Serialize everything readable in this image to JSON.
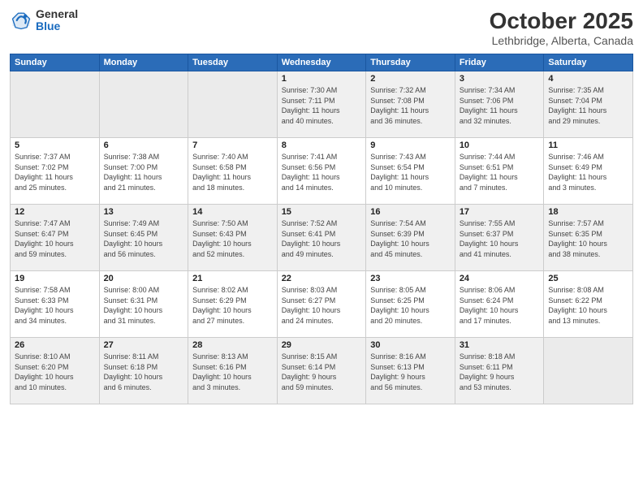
{
  "header": {
    "logo_general": "General",
    "logo_blue": "Blue",
    "month": "October 2025",
    "location": "Lethbridge, Alberta, Canada"
  },
  "days_of_week": [
    "Sunday",
    "Monday",
    "Tuesday",
    "Wednesday",
    "Thursday",
    "Friday",
    "Saturday"
  ],
  "weeks": [
    [
      {
        "day": "",
        "info": ""
      },
      {
        "day": "",
        "info": ""
      },
      {
        "day": "",
        "info": ""
      },
      {
        "day": "1",
        "info": "Sunrise: 7:30 AM\nSunset: 7:11 PM\nDaylight: 11 hours\nand 40 minutes."
      },
      {
        "day": "2",
        "info": "Sunrise: 7:32 AM\nSunset: 7:08 PM\nDaylight: 11 hours\nand 36 minutes."
      },
      {
        "day": "3",
        "info": "Sunrise: 7:34 AM\nSunset: 7:06 PM\nDaylight: 11 hours\nand 32 minutes."
      },
      {
        "day": "4",
        "info": "Sunrise: 7:35 AM\nSunset: 7:04 PM\nDaylight: 11 hours\nand 29 minutes."
      }
    ],
    [
      {
        "day": "5",
        "info": "Sunrise: 7:37 AM\nSunset: 7:02 PM\nDaylight: 11 hours\nand 25 minutes."
      },
      {
        "day": "6",
        "info": "Sunrise: 7:38 AM\nSunset: 7:00 PM\nDaylight: 11 hours\nand 21 minutes."
      },
      {
        "day": "7",
        "info": "Sunrise: 7:40 AM\nSunset: 6:58 PM\nDaylight: 11 hours\nand 18 minutes."
      },
      {
        "day": "8",
        "info": "Sunrise: 7:41 AM\nSunset: 6:56 PM\nDaylight: 11 hours\nand 14 minutes."
      },
      {
        "day": "9",
        "info": "Sunrise: 7:43 AM\nSunset: 6:54 PM\nDaylight: 11 hours\nand 10 minutes."
      },
      {
        "day": "10",
        "info": "Sunrise: 7:44 AM\nSunset: 6:51 PM\nDaylight: 11 hours\nand 7 minutes."
      },
      {
        "day": "11",
        "info": "Sunrise: 7:46 AM\nSunset: 6:49 PM\nDaylight: 11 hours\nand 3 minutes."
      }
    ],
    [
      {
        "day": "12",
        "info": "Sunrise: 7:47 AM\nSunset: 6:47 PM\nDaylight: 10 hours\nand 59 minutes."
      },
      {
        "day": "13",
        "info": "Sunrise: 7:49 AM\nSunset: 6:45 PM\nDaylight: 10 hours\nand 56 minutes."
      },
      {
        "day": "14",
        "info": "Sunrise: 7:50 AM\nSunset: 6:43 PM\nDaylight: 10 hours\nand 52 minutes."
      },
      {
        "day": "15",
        "info": "Sunrise: 7:52 AM\nSunset: 6:41 PM\nDaylight: 10 hours\nand 49 minutes."
      },
      {
        "day": "16",
        "info": "Sunrise: 7:54 AM\nSunset: 6:39 PM\nDaylight: 10 hours\nand 45 minutes."
      },
      {
        "day": "17",
        "info": "Sunrise: 7:55 AM\nSunset: 6:37 PM\nDaylight: 10 hours\nand 41 minutes."
      },
      {
        "day": "18",
        "info": "Sunrise: 7:57 AM\nSunset: 6:35 PM\nDaylight: 10 hours\nand 38 minutes."
      }
    ],
    [
      {
        "day": "19",
        "info": "Sunrise: 7:58 AM\nSunset: 6:33 PM\nDaylight: 10 hours\nand 34 minutes."
      },
      {
        "day": "20",
        "info": "Sunrise: 8:00 AM\nSunset: 6:31 PM\nDaylight: 10 hours\nand 31 minutes."
      },
      {
        "day": "21",
        "info": "Sunrise: 8:02 AM\nSunset: 6:29 PM\nDaylight: 10 hours\nand 27 minutes."
      },
      {
        "day": "22",
        "info": "Sunrise: 8:03 AM\nSunset: 6:27 PM\nDaylight: 10 hours\nand 24 minutes."
      },
      {
        "day": "23",
        "info": "Sunrise: 8:05 AM\nSunset: 6:25 PM\nDaylight: 10 hours\nand 20 minutes."
      },
      {
        "day": "24",
        "info": "Sunrise: 8:06 AM\nSunset: 6:24 PM\nDaylight: 10 hours\nand 17 minutes."
      },
      {
        "day": "25",
        "info": "Sunrise: 8:08 AM\nSunset: 6:22 PM\nDaylight: 10 hours\nand 13 minutes."
      }
    ],
    [
      {
        "day": "26",
        "info": "Sunrise: 8:10 AM\nSunset: 6:20 PM\nDaylight: 10 hours\nand 10 minutes."
      },
      {
        "day": "27",
        "info": "Sunrise: 8:11 AM\nSunset: 6:18 PM\nDaylight: 10 hours\nand 6 minutes."
      },
      {
        "day": "28",
        "info": "Sunrise: 8:13 AM\nSunset: 6:16 PM\nDaylight: 10 hours\nand 3 minutes."
      },
      {
        "day": "29",
        "info": "Sunrise: 8:15 AM\nSunset: 6:14 PM\nDaylight: 9 hours\nand 59 minutes."
      },
      {
        "day": "30",
        "info": "Sunrise: 8:16 AM\nSunset: 6:13 PM\nDaylight: 9 hours\nand 56 minutes."
      },
      {
        "day": "31",
        "info": "Sunrise: 8:18 AM\nSunset: 6:11 PM\nDaylight: 9 hours\nand 53 minutes."
      },
      {
        "day": "",
        "info": ""
      }
    ]
  ]
}
